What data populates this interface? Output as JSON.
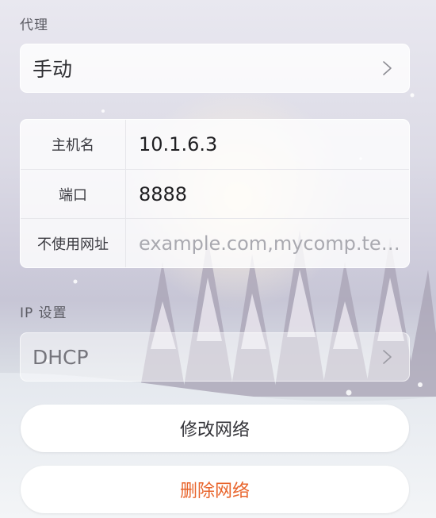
{
  "proxy": {
    "section_label": "代理",
    "mode_value": "手动"
  },
  "proxy_form": {
    "host": {
      "label": "主机名",
      "value": "10.1.6.3"
    },
    "port": {
      "label": "端口",
      "value": "8888"
    },
    "bypass": {
      "label": "不使用网址",
      "placeholder": "example.com,mycomp.test.com"
    }
  },
  "ip_settings": {
    "section_label": "IP 设置",
    "mode_value": "DHCP"
  },
  "actions": {
    "modify_label": "修改网络",
    "delete_label": "删除网络"
  },
  "colors": {
    "delete_text": "#e8642b",
    "accent_snow": "#ffffff"
  },
  "icons": {
    "chevron": "chevron-right-icon"
  }
}
